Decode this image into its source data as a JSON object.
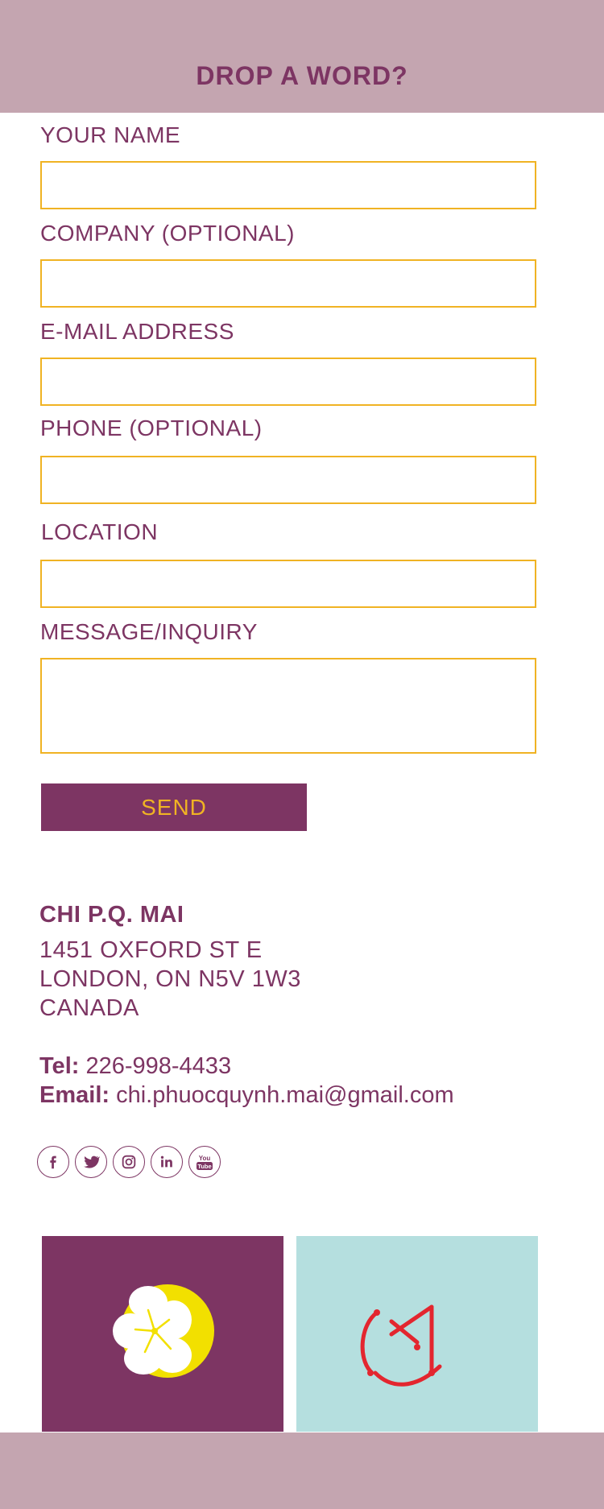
{
  "header": {
    "title": "DROP A WORD?"
  },
  "form": {
    "name_label": "YOUR NAME",
    "company_label": "COMPANY (OPTIONAL)",
    "email_label": "E-MAIL ADDRESS",
    "phone_label": "PHONE (OPTIONAL)",
    "location_label": "LOCATION",
    "message_label": "MESSAGE/INQUIRY",
    "name_value": "",
    "company_value": "",
    "email_value": "",
    "phone_value": "",
    "location_value": "",
    "message_value": "",
    "send_label": "SEND"
  },
  "contact": {
    "name": "CHI P.Q. MAI",
    "address": [
      "1451 OXFORD ST E",
      "LONDON, ON N5V 1W3",
      "CANADA"
    ],
    "tel_label": "Tel:",
    "tel_value": "226-998-4433",
    "email_label": "Email:",
    "email_value": "chi.phuocquynh.mai@gmail.com"
  },
  "social": [
    {
      "name": "facebook-icon"
    },
    {
      "name": "twitter-icon"
    },
    {
      "name": "instagram-icon"
    },
    {
      "name": "linkedin-icon"
    },
    {
      "name": "youtube-icon",
      "glyph_top": "You",
      "glyph_bottom": "Tube"
    }
  ],
  "tiles": [
    {
      "name": "flower-logo-tile",
      "color": "#7d3563",
      "icon": "flower-icon"
    },
    {
      "name": "monogram-logo-tile",
      "color": "#b5dfdf",
      "icon": "monogram-icon"
    }
  ],
  "colors": {
    "brand": "#7d3563",
    "accent": "#f0b323",
    "band": "#c4a5b0",
    "teal": "#b5dfdf",
    "logo_red": "#e3262f",
    "logo_yellow": "#f2e000"
  }
}
